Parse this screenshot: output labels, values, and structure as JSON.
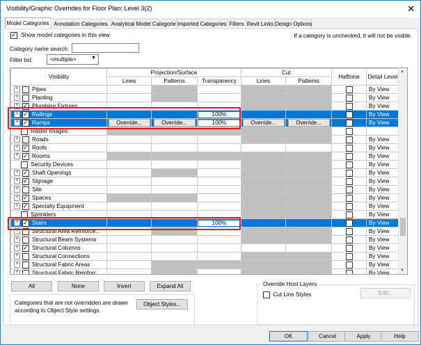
{
  "window": {
    "title": "Visibility/Graphic Overrides for Floor Plan: Level 3(2)",
    "close_glyph": "✕"
  },
  "tabs": [
    {
      "label": "Model Categories",
      "active": true
    },
    {
      "label": "Annotation Categories"
    },
    {
      "label": "Analytical Model Categories"
    },
    {
      "label": "Imported Categories"
    },
    {
      "label": "Filters"
    },
    {
      "label": "Revit Links"
    },
    {
      "label": "Design Options"
    }
  ],
  "top": {
    "show_model_label": "Show model categories in this view",
    "note": "If a category is unchecked, it will not be visible.",
    "search_label": "Category name search:",
    "search_value": "",
    "filter_label": "Filter list:",
    "filter_value": "<multiple>"
  },
  "grid": {
    "headers": {
      "visibility": "Visibility",
      "projection": "Projection/Surface",
      "cut": "Cut",
      "halftone": "Halftone",
      "detail": "Detail Level",
      "lines": "Lines",
      "patterns": "Patterns",
      "transparency": "Transparency",
      "cut_lines": "Lines",
      "cut_patterns": "Patterns"
    },
    "override_label": "Override...",
    "rows": [
      {
        "name": "Pipes",
        "checked": false,
        "expand": true,
        "detail": "By View",
        "gray": [
          1,
          3,
          4
        ]
      },
      {
        "name": "Planting",
        "checked": false,
        "expand": true,
        "detail": "By View",
        "gray": [
          1,
          3,
          4
        ]
      },
      {
        "name": "Plumbing Fixtures",
        "checked": true,
        "expand": true,
        "detail": "By View",
        "gray": [
          3,
          4
        ]
      },
      {
        "name": "Railings",
        "checked": true,
        "expand": true,
        "detail": "By View",
        "selected": true,
        "transparency": "100%"
      },
      {
        "name": "Ramps",
        "checked": true,
        "expand": true,
        "detail": "By View",
        "selected": true,
        "overrides": true,
        "transparency": "100%"
      },
      {
        "name": "Raster Images",
        "checked": false,
        "expand": false,
        "detail": "",
        "gray": [
          0,
          1,
          2,
          3,
          4
        ]
      },
      {
        "name": "Roads",
        "checked": false,
        "expand": true,
        "detail": "By View",
        "gray": [
          3,
          4
        ]
      },
      {
        "name": "Roofs",
        "checked": true,
        "expand": true,
        "detail": "By View",
        "gray": []
      },
      {
        "name": "Rooms",
        "checked": true,
        "expand": true,
        "detail": "By View",
        "gray": [
          0,
          1,
          2,
          3,
          4
        ]
      },
      {
        "name": "Security Devices",
        "checked": false,
        "expand": false,
        "detail": "By View",
        "gray": [
          3,
          4
        ]
      },
      {
        "name": "Shaft Openings",
        "checked": true,
        "expand": true,
        "detail": "By View",
        "gray": [
          1,
          3,
          4
        ]
      },
      {
        "name": "Signage",
        "checked": true,
        "expand": true,
        "detail": "By View",
        "gray": [
          3,
          4
        ]
      },
      {
        "name": "Site",
        "checked": false,
        "expand": true,
        "detail": "By View",
        "gray": [
          3,
          4
        ]
      },
      {
        "name": "Spaces",
        "checked": true,
        "expand": true,
        "detail": "By View",
        "gray": [
          0,
          1,
          3,
          4
        ]
      },
      {
        "name": "Specialty Equipment",
        "checked": true,
        "expand": true,
        "detail": "By View",
        "gray": [
          3,
          4
        ]
      },
      {
        "name": "Sprinklers",
        "checked": false,
        "expand": false,
        "detail": "By View",
        "gray": [
          3,
          4
        ]
      },
      {
        "name": "Stairs",
        "checked": true,
        "expand": true,
        "detail": "By View",
        "selected": true,
        "transparency": "100%"
      },
      {
        "name": "Structural Area Reinforce...",
        "checked": false,
        "expand": true,
        "detail": "By View",
        "gray": [
          1,
          3,
          4
        ]
      },
      {
        "name": "Structural Beam Systems",
        "checked": false,
        "expand": true,
        "detail": "By View",
        "gray": [
          3,
          4
        ]
      },
      {
        "name": "Structural Columns",
        "checked": true,
        "expand": true,
        "detail": "By View",
        "gray": []
      },
      {
        "name": "Structural Connections",
        "checked": false,
        "expand": true,
        "detail": "By View",
        "gray": [
          3,
          4
        ]
      },
      {
        "name": "Structural Fabric Areas",
        "checked": false,
        "expand": true,
        "detail": "By View",
        "gray": [
          1,
          2,
          3,
          4
        ]
      },
      {
        "name": "Structural Fabric Reinforc...",
        "checked": false,
        "expand": true,
        "detail": "By View",
        "gray": [
          1,
          3,
          4
        ]
      }
    ]
  },
  "buttons": {
    "all": "All",
    "none": "None",
    "invert": "Invert",
    "expand_all": "Expand All",
    "object_styles": "Object Styles...",
    "edit": "Edit...",
    "ok": "OK",
    "cancel": "Cancel",
    "apply": "Apply",
    "help": "Help"
  },
  "info_text": "Categories that are not overridden are drawn according to Object Style settings.",
  "override_host": {
    "legend": "Override Host Layers",
    "cut_line_styles": "Cut Line Styles"
  },
  "colors": {
    "selection": "#0078d7",
    "highlight_box": "#e01919"
  }
}
